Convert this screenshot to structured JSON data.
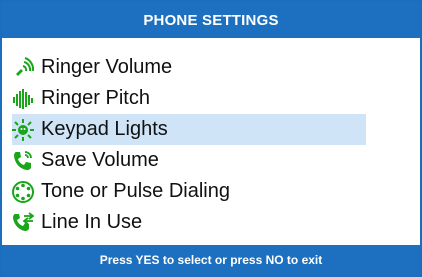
{
  "header": {
    "title": "PHONE SETTINGS"
  },
  "menu": {
    "items": [
      {
        "label": "Ringer Volume",
        "icon": "ringer-volume-icon",
        "selected": false
      },
      {
        "label": "Ringer Pitch",
        "icon": "ringer-pitch-icon",
        "selected": false
      },
      {
        "label": "Keypad Lights",
        "icon": "keypad-lights-icon",
        "selected": true
      },
      {
        "label": "Save Volume",
        "icon": "save-volume-icon",
        "selected": false
      },
      {
        "label": "Tone or Pulse Dialing",
        "icon": "tone-pulse-icon",
        "selected": false
      },
      {
        "label": "Line In Use",
        "icon": "line-in-use-icon",
        "selected": false
      }
    ]
  },
  "footer": {
    "hint": "Press YES to select or press NO to exit"
  },
  "colors": {
    "header_bg": "#1d70c0",
    "icon_green": "#1aa51a",
    "selected_bg": "#cfe5f7"
  }
}
